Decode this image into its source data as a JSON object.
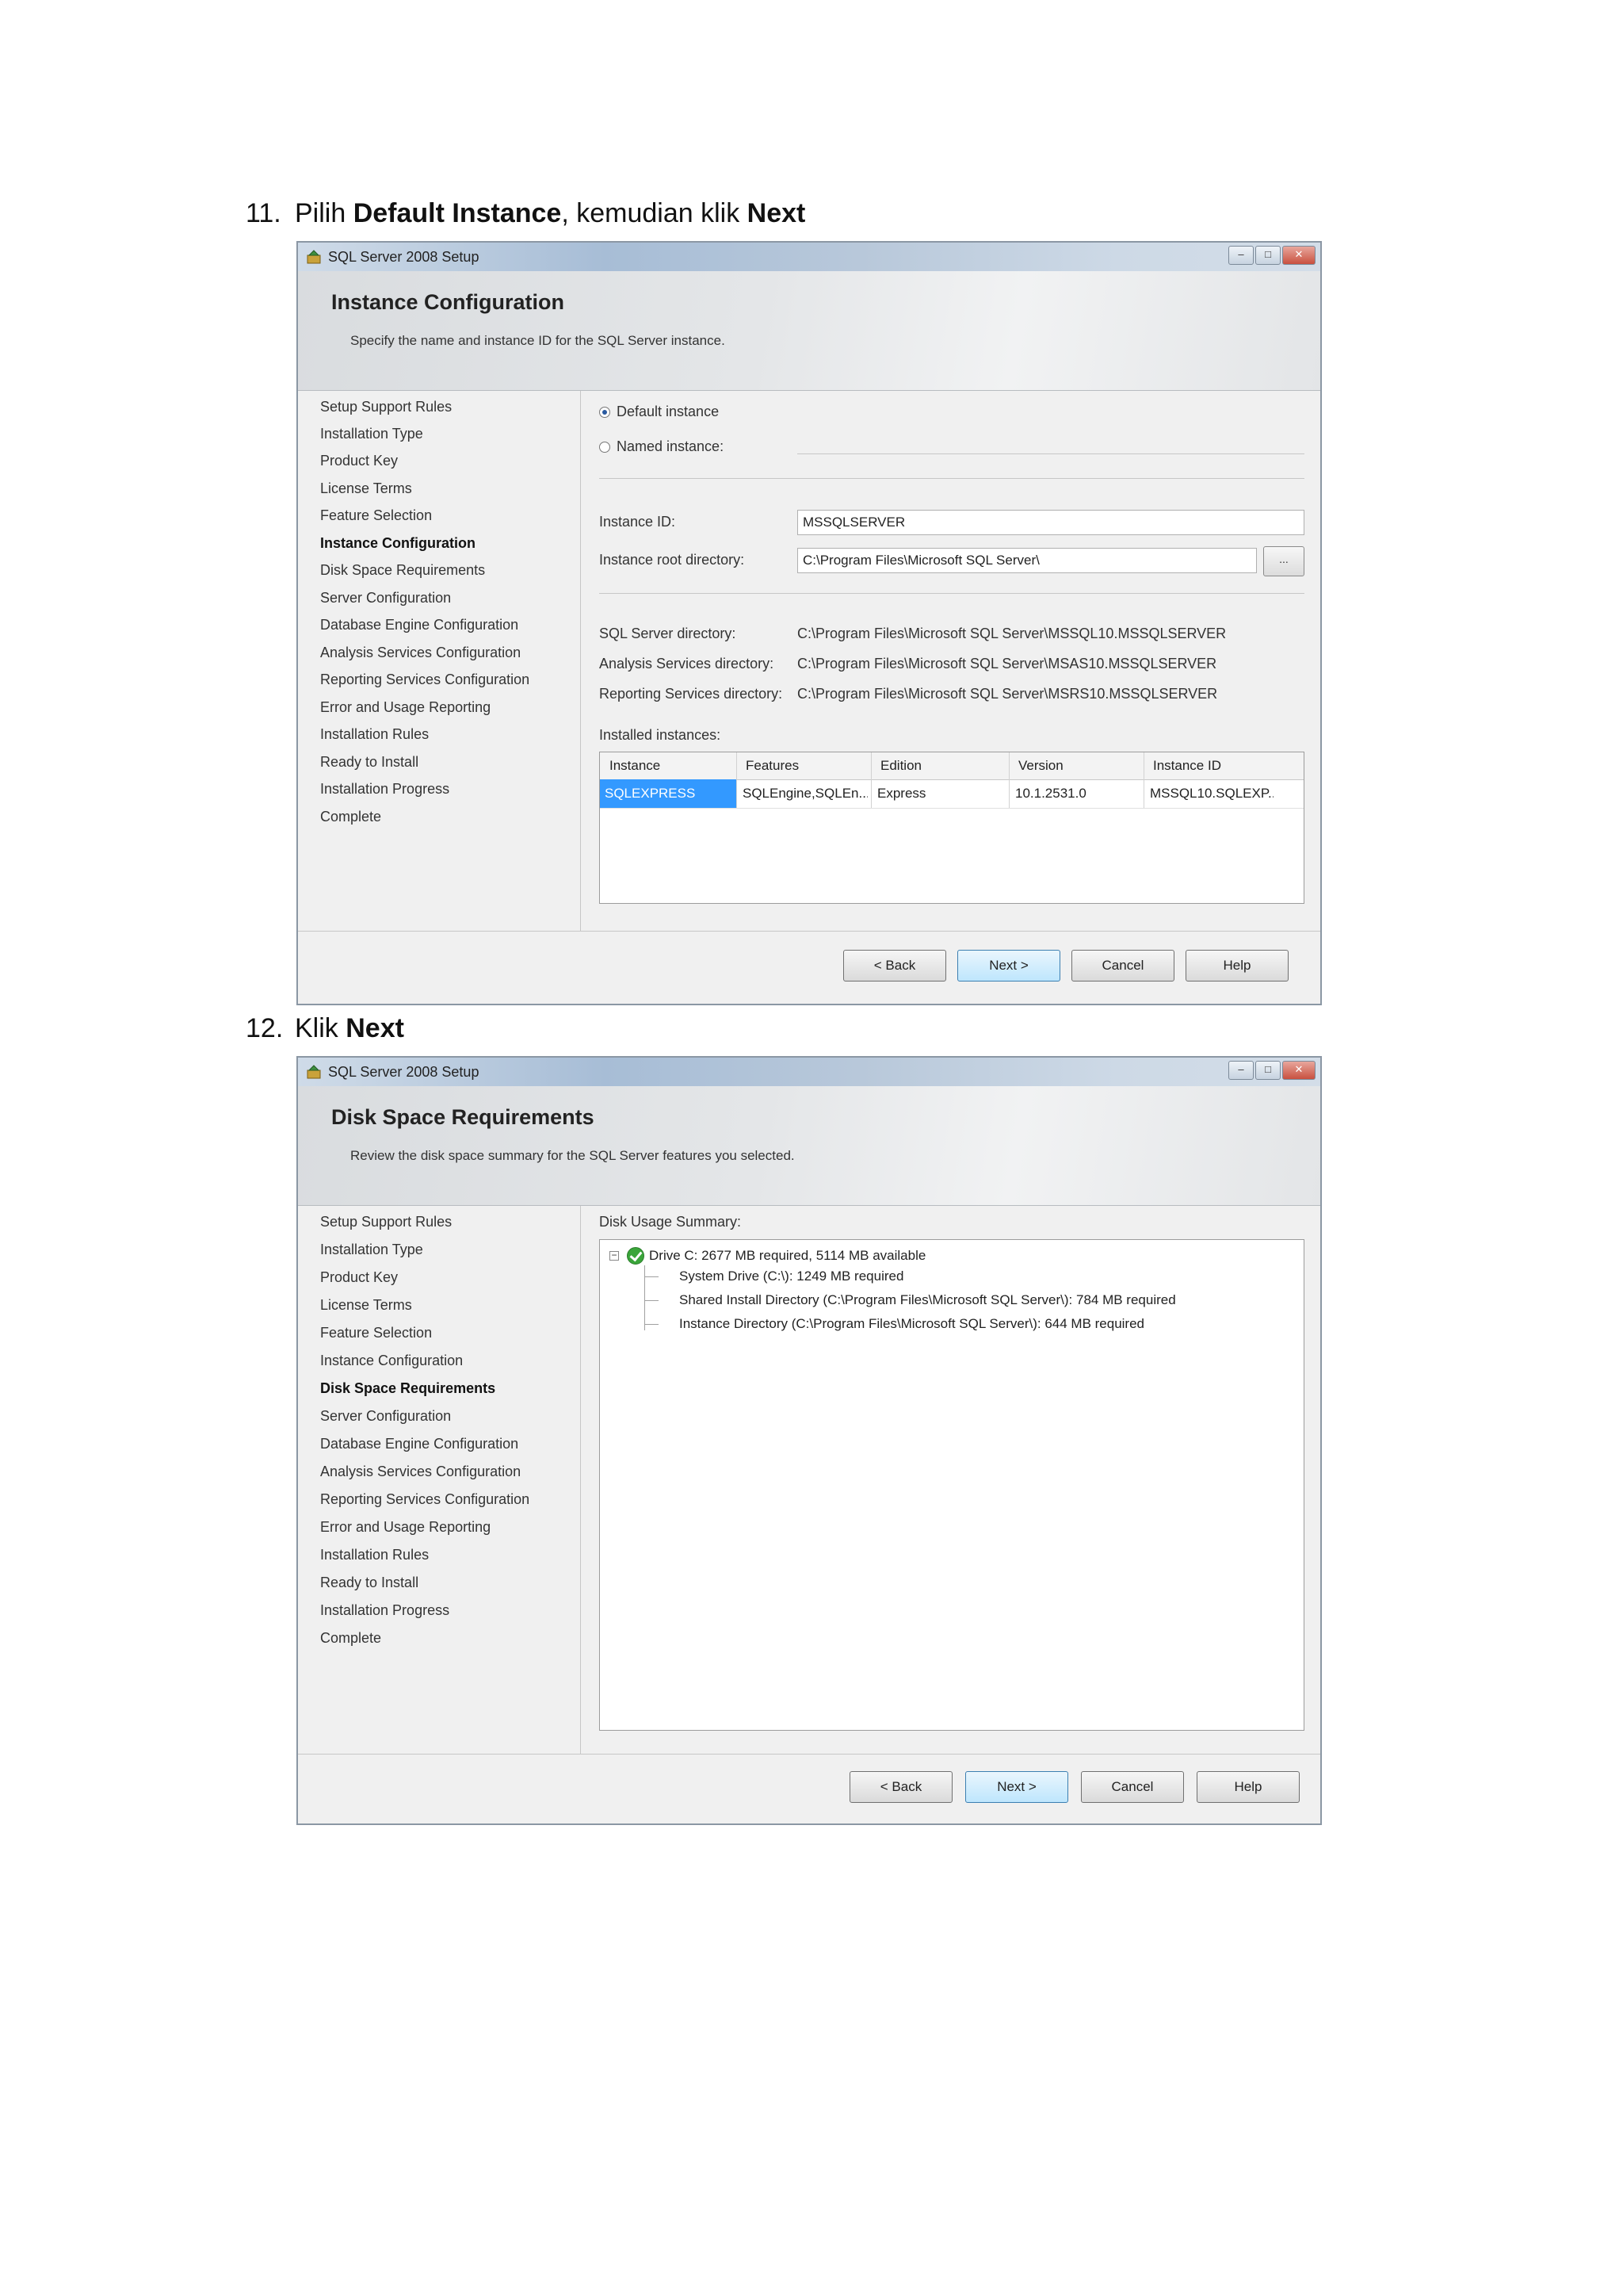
{
  "step11": {
    "number": "11.",
    "text_pre": "Pilih ",
    "text_bold1": "Default Instance",
    "text_mid": ", kemudian klik ",
    "text_bold2": "Next"
  },
  "step12": {
    "number": "12.",
    "text_pre": "Klik ",
    "text_bold": "Next"
  },
  "window": {
    "title": "SQL Server 2008 Setup",
    "nav_items": [
      "Setup Support Rules",
      "Installation Type",
      "Product Key",
      "License Terms",
      "Feature Selection",
      "Instance Configuration",
      "Disk Space Requirements",
      "Server Configuration",
      "Database Engine Configuration",
      "Analysis Services Configuration",
      "Reporting Services Configuration",
      "Error and Usage Reporting",
      "Installation Rules",
      "Ready to Install",
      "Installation Progress",
      "Complete"
    ],
    "buttons": {
      "back": "< Back",
      "next": "Next >",
      "cancel": "Cancel",
      "help": "Help"
    }
  },
  "instance_config": {
    "title": "Instance Configuration",
    "subtitle": "Specify the name and instance ID for the SQL Server instance.",
    "default_instance": "Default instance",
    "named_instance": "Named instance:",
    "instance_id_label": "Instance ID:",
    "instance_id_value": "MSSQLSERVER",
    "root_dir_label": "Instance root directory:",
    "root_dir_value": "C:\\Program Files\\Microsoft SQL Server\\",
    "browse": "...",
    "sql_dir_label": "SQL Server directory:",
    "sql_dir_value": "C:\\Program Files\\Microsoft SQL Server\\MSSQL10.MSSQLSERVER",
    "as_dir_label": "Analysis Services directory:",
    "as_dir_value": "C:\\Program Files\\Microsoft SQL Server\\MSAS10.MSSQLSERVER",
    "rs_dir_label": "Reporting Services directory:",
    "rs_dir_value": "C:\\Program Files\\Microsoft SQL Server\\MSRS10.MSSQLSERVER",
    "installed_label": "Installed instances:",
    "columns": [
      "Instance",
      "Features",
      "Edition",
      "Version",
      "Instance ID"
    ],
    "rows": [
      [
        "SQLEXPRESS",
        "SQLEngine,SQLEn...",
        "Express",
        "10.1.2531.0",
        "MSSQL10.SQLEXP..."
      ]
    ]
  },
  "disk_space": {
    "title": "Disk Space Requirements",
    "subtitle": "Review the disk space summary for the SQL Server features you selected.",
    "summary_label": "Disk Usage Summary:",
    "drive": "Drive C: 2677 MB required, 5114 MB available",
    "details": [
      "System Drive (C:\\): 1249 MB required",
      "Shared Install Directory (C:\\Program Files\\Microsoft SQL Server\\): 784 MB required",
      "Instance Directory (C:\\Program Files\\Microsoft SQL Server\\): 644 MB required"
    ]
  },
  "colors": {
    "selection": "#3399ff",
    "primary_button": "#bee6fd",
    "check": "#3aa53a"
  }
}
